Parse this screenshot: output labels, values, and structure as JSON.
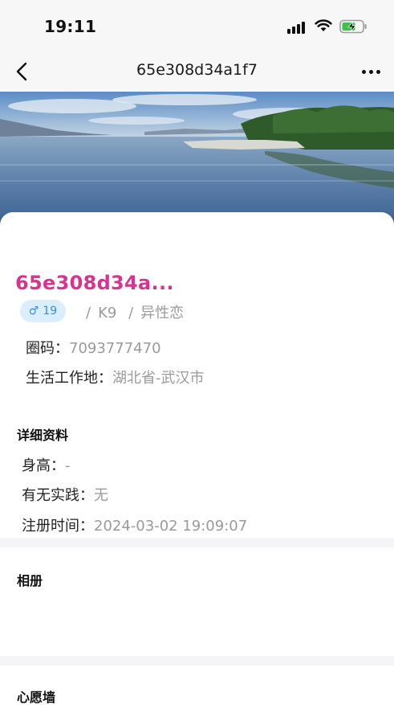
{
  "status_bar": {
    "time": "19:11"
  },
  "nav": {
    "title": "65e308d34a1f7"
  },
  "profile": {
    "name": "65e308d34a...",
    "age": "19",
    "tags": [
      "K9",
      "异性恋"
    ],
    "circle_code_label": "圈码：",
    "circle_code": "7093777470",
    "location_label": "生活工作地：",
    "location": "湖北省-武汉市"
  },
  "details": {
    "title": "详细资料",
    "height_label": "身高：",
    "height": "-",
    "practice_label": "有无实践：",
    "practice": "无",
    "registered_label": "注册时间：",
    "registered": "2024-03-02 19:09:07"
  },
  "album": {
    "title": "相册"
  },
  "wishwall": {
    "title": "心愿墙"
  },
  "colors": {
    "name": "#d8338f",
    "badge_bg": "#dbeeff",
    "badge_text": "#3a8de0",
    "muted": "#9a9a9a"
  },
  "icons": [
    "signal-icon",
    "wifi-icon",
    "battery-charging-icon",
    "back-chevron-icon",
    "more-dots-icon",
    "male-icon"
  ]
}
